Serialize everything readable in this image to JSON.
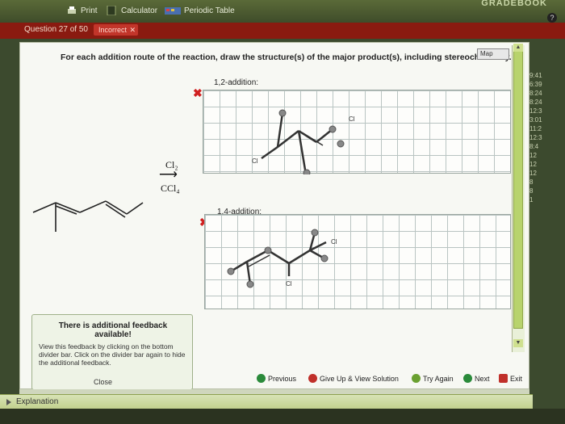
{
  "toolbar": {
    "print_label": "Print",
    "calculator_label": "Calculator",
    "periodic_label": "Periodic Table",
    "gradebook_label": "GRADEBOOK",
    "help_label": "?"
  },
  "question": {
    "number_label": "Question 27 of 50",
    "status_label": "Incorrect",
    "instruction": "For each addition route of the reaction, draw the structure(s) of the major product(s), including stereochemistry.",
    "map_label": "Map"
  },
  "reaction": {
    "reagent_top": "Cl₂",
    "reagent_bottom": "CCl₄",
    "grid1_label": "1,2-addition:",
    "grid2_label": "1,4-addition:",
    "atom_label": "Cl"
  },
  "feedback": {
    "title": "There is additional feedback available!",
    "body": "View this feedback by clicking on the bottom divider bar. Click on the divider bar again to hide the additional feedback.",
    "close_label": "Close"
  },
  "nav": {
    "previous_label": "Previous",
    "giveup_label": "Give Up & View Solution",
    "tryagain_label": "Try Again",
    "next_label": "Next",
    "exit_label": "Exit"
  },
  "explanation_label": "Explanation",
  "side_times": [
    "9:41",
    "6:39",
    "8:24",
    "8:24",
    "12:3",
    "3:01",
    "11:2",
    "12:3",
    "8:4",
    "12",
    "12",
    "12",
    "8",
    "8",
    "1"
  ],
  "colors": {
    "incorrect": "#d02020",
    "accent": "#b8d36d"
  }
}
